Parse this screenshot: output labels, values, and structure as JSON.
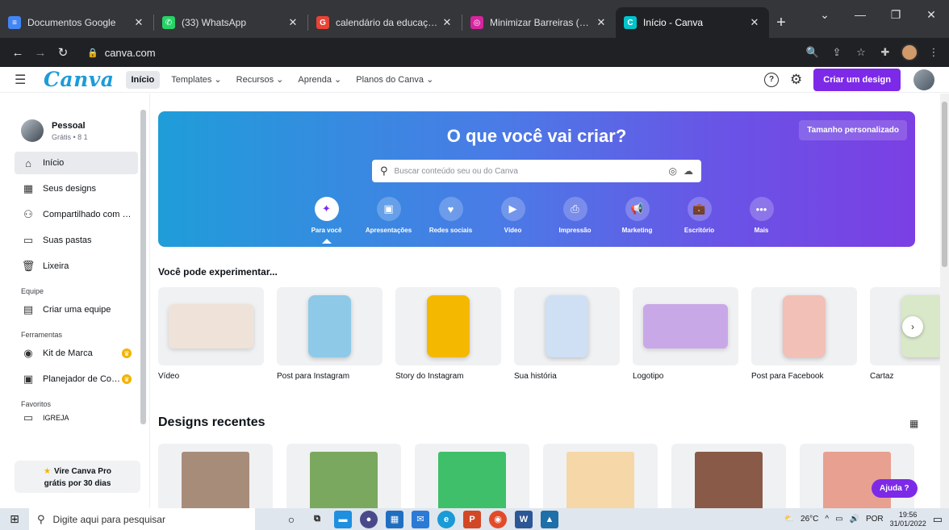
{
  "browser": {
    "tabs": [
      {
        "title": "Documentos Google",
        "icon": "google-docs-icon",
        "color": "#4285f4",
        "glyph": "≡",
        "active": false
      },
      {
        "title": "(33) WhatsApp",
        "icon": "whatsapp-icon",
        "color": "#25d366",
        "glyph": "✆",
        "active": false
      },
      {
        "title": "calendário da educação espe",
        "icon": "google-icon",
        "color": "#ea4335",
        "glyph": "G",
        "active": false
      },
      {
        "title": "Minimizar Barreiras (@minim",
        "icon": "instagram-icon",
        "color": "#d6249f",
        "glyph": "◎",
        "active": false
      },
      {
        "title": "Início - Canva",
        "icon": "canva-icon",
        "color": "#00c4cc",
        "glyph": "C",
        "active": true
      }
    ],
    "url": "canva.com"
  },
  "header": {
    "logo": "Canva",
    "nav": {
      "home": "Início",
      "templates": "Templates ⌄",
      "resources": "Recursos ⌄",
      "learn": "Aprenda ⌄",
      "plans": "Planos do Canva ⌄"
    },
    "help_glyph": "?",
    "create_button": "Criar um design"
  },
  "sidebar": {
    "profile": {
      "name": "Pessoal",
      "sub": "Grátis • 8 1"
    },
    "items": [
      {
        "label": "Início",
        "icon": "home-icon",
        "glyph": "⌂"
      },
      {
        "label": "Seus designs",
        "icon": "grid-icon",
        "glyph": "▦"
      },
      {
        "label": "Compartilhado com v...",
        "icon": "shared-users-icon",
        "glyph": "⚇"
      },
      {
        "label": "Suas pastas",
        "icon": "folder-icon",
        "glyph": "▭"
      },
      {
        "label": "Lixeira",
        "icon": "trash-icon",
        "glyph": "🗑"
      }
    ],
    "section_team": "Equipe",
    "team_item": {
      "label": "Criar uma equipe",
      "icon": "team-icon",
      "glyph": "▤"
    },
    "section_tools": "Ferramentas",
    "tools": [
      {
        "label": "Kit de Marca",
        "icon": "brand-kit-icon",
        "glyph": "◉"
      },
      {
        "label": "Planejador de Conteú...",
        "icon": "calendar-icon",
        "glyph": "▣"
      }
    ],
    "section_favorites": "Favoritos",
    "favorite_item": {
      "label": "IGREJA",
      "icon": "folder-icon",
      "glyph": "▭"
    },
    "pro_line1": "Vire Canva Pro",
    "pro_line2": "grátis por 30 dias"
  },
  "hero": {
    "title": "O que você vai criar?",
    "custom_size": "Tamanho personalizado",
    "search_placeholder": "Buscar conteúdo seu ou do Canva",
    "categories": [
      {
        "label": "Para você",
        "icon": "sparkle-icon",
        "glyph": "✦"
      },
      {
        "label": "Apresentações",
        "icon": "presentation-icon",
        "glyph": "▣"
      },
      {
        "label": "Redes sociais",
        "icon": "heart-chat-icon",
        "glyph": "♥"
      },
      {
        "label": "Vídeo",
        "icon": "video-icon",
        "glyph": "▶"
      },
      {
        "label": "Impressão",
        "icon": "print-icon",
        "glyph": "⎙"
      },
      {
        "label": "Marketing",
        "icon": "megaphone-icon",
        "glyph": "📢"
      },
      {
        "label": "Escritório",
        "icon": "briefcase-icon",
        "glyph": "💼"
      },
      {
        "label": "Mais",
        "icon": "more-icon",
        "glyph": "•••"
      }
    ]
  },
  "suggestions": {
    "title": "Você pode experimentar...",
    "items": [
      {
        "label": "Vídeo",
        "color": "#efe3d9"
      },
      {
        "label": "Post para Instagram",
        "color": "#8ec9e8"
      },
      {
        "label": "Story do Instagram",
        "color": "#f5b800"
      },
      {
        "label": "Sua história",
        "color": "#cfe0f5"
      },
      {
        "label": "Logotipo",
        "color": "#c9a8e8"
      },
      {
        "label": "Post para Facebook",
        "color": "#f2c0b6"
      },
      {
        "label": "Cartaz",
        "color": "#d8e8c8"
      }
    ]
  },
  "recent": {
    "title": "Designs recentes",
    "items": [
      {
        "color": "#a88c7a"
      },
      {
        "color": "#7aa85e"
      },
      {
        "color": "#3fbf6a"
      },
      {
        "color": "#f5d7a8"
      },
      {
        "color": "#8a5a48"
      },
      {
        "color": "#e8a090"
      }
    ]
  },
  "help_button": "Ajuda ?",
  "taskbar": {
    "search_placeholder": "Digite aqui para pesquisar",
    "weather": "26°C",
    "language": "POR",
    "time": "19:56",
    "date": "31/01/2022"
  }
}
